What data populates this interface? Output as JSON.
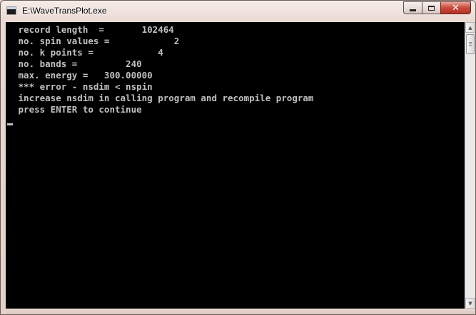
{
  "window": {
    "title": "E:\\WaveTransPlot.exe",
    "icon": "console-app-icon",
    "buttons": {
      "minimize": "minimize-icon",
      "maximize": "maximize-icon",
      "close": "✕"
    }
  },
  "console": {
    "lines": [
      " record length  =       102464",
      " no. spin values =            2",
      " no. k points =            4",
      " no. bands =         240",
      " max. energy =   300.00000",
      " *** error - nsdim < nspin",
      " increase nsdim in calling program and recompile program",
      " press ENTER to continue"
    ],
    "text_color": "#c0c0c0",
    "background": "#000000"
  },
  "scrollbar": {
    "up_arrow": "▲",
    "down_arrow": "▼"
  }
}
